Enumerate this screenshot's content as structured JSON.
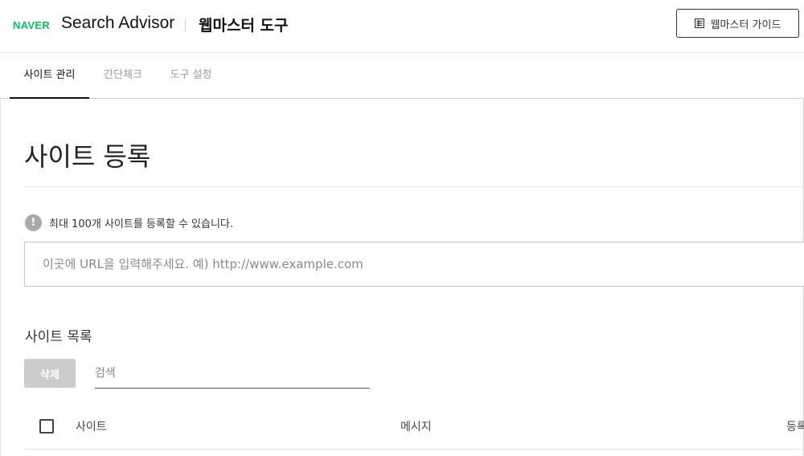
{
  "header": {
    "logo": "NAVER",
    "product": "Search Advisor",
    "tool_title": "웹마스터 도구",
    "guide_button": "웹마스터 가이드"
  },
  "tabs": [
    {
      "label": "사이트 관리",
      "active": true
    },
    {
      "label": "간단체크",
      "active": false
    },
    {
      "label": "도구 설정",
      "active": false
    }
  ],
  "page": {
    "title": "사이트 등록",
    "notice_icon": "!",
    "notice": "최대 100개 사이트를 등록할 수 있습니다.",
    "url_placeholder": "이곳에 URL을 입력해주세요. 예) http://www.example.com"
  },
  "site_list": {
    "title": "사이트 목록",
    "delete_button": "삭제",
    "search_placeholder": "검색",
    "columns": [
      "사이트",
      "메시지",
      "등록"
    ]
  },
  "icons": {
    "guide": "document-list-icon",
    "notice": "info-circle-icon",
    "select_all": "checkbox-icon"
  },
  "colors": {
    "brand_green": "#03c75a",
    "delete_disabled": "#cccccc",
    "notice_icon": "#a8a8a8"
  }
}
